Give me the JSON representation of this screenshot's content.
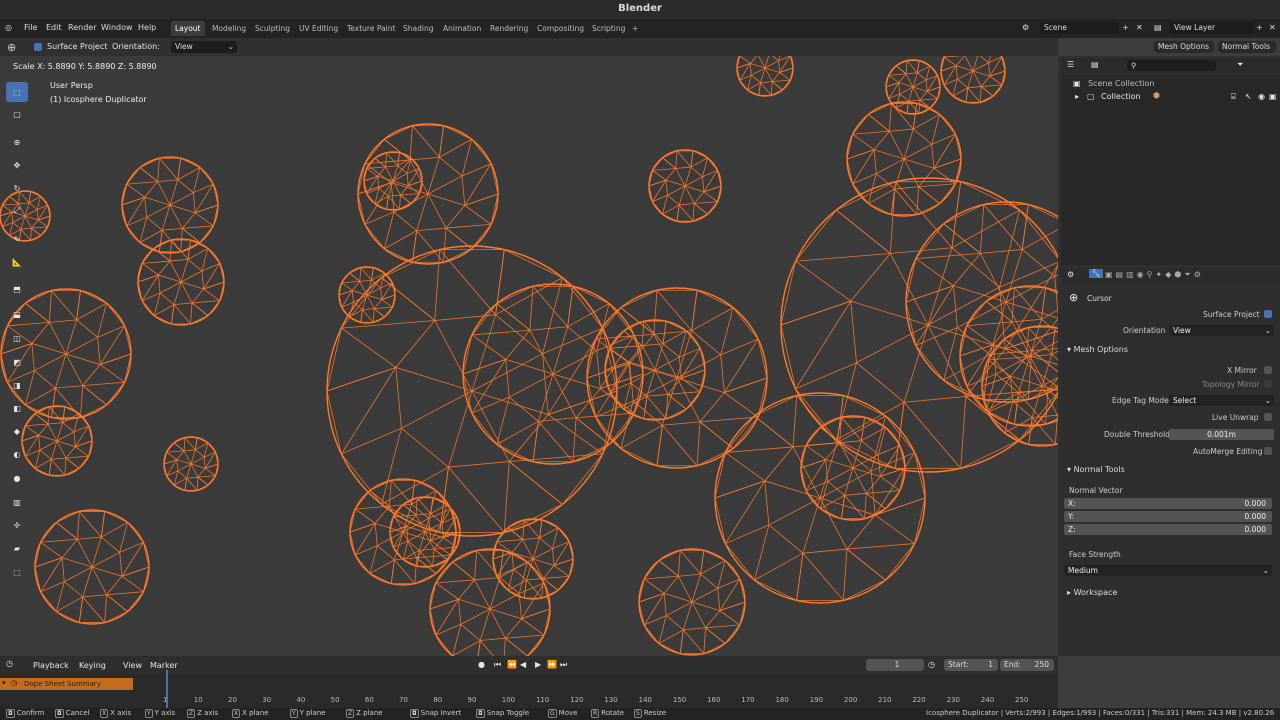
{
  "window": {
    "title": "Blender"
  },
  "menu": {
    "items": [
      "File",
      "Edit",
      "Render",
      "Window",
      "Help"
    ]
  },
  "workspaces": {
    "tabs": [
      "Layout",
      "Modeling",
      "Sculpting",
      "UV Editing",
      "Texture Paint",
      "Shading",
      "Animation",
      "Rendering",
      "Compositing",
      "Scripting"
    ],
    "active": "Layout",
    "add": "+"
  },
  "scene": {
    "name": "Scene",
    "view_layer": "View Layer"
  },
  "tool_header": {
    "surface_project_label": "Surface Project",
    "orientation_label": "Orientation:",
    "orientation_value": "View",
    "mesh_options": "Mesh Options",
    "normal_tools": "Normal Tools"
  },
  "viewport": {
    "scale_readout": "Scale X: 5.8890   Y: 5.8890   Z: 5.8890",
    "view_name": "User Persp",
    "object_name": "(1) Icosphere Duplicator",
    "wire_color": "#ff7a2a"
  },
  "outliner": {
    "search_placeholder": "",
    "scene_collection": "Scene Collection",
    "collection": "Collection"
  },
  "properties": {
    "tool_name": "Cursor",
    "surface_project": "Surface Project",
    "orientation_label": "Orientation",
    "orientation_value": "View",
    "mesh_options": {
      "title": "Mesh Options",
      "x_mirror": "X Mirror",
      "topology_mirror": "Topology Mirror",
      "edge_tag_mode_label": "Edge Tag Mode",
      "edge_tag_mode_value": "Select",
      "live_unwrap": "Live Unwrap",
      "double_threshold_label": "Double Threshold",
      "double_threshold_value": "0.001m",
      "automerge": "AutoMerge Editing"
    },
    "normal_tools": {
      "title": "Normal Tools",
      "normal_vector": "Normal Vector",
      "x_label": "X:",
      "x_value": "0.000",
      "y_label": "Y:",
      "y_value": "0.000",
      "z_label": "Z:",
      "z_value": "0.000",
      "face_strength_label": "Face Strength",
      "face_strength_value": "Medium"
    },
    "workspace": "Workspace"
  },
  "timeline": {
    "menus": [
      "Playback",
      "Keying",
      "View",
      "Marker"
    ],
    "current_frame": "1",
    "start_label": "Start:",
    "start_value": "1",
    "end_label": "End:",
    "end_value": "250",
    "channel": "Dope Sheet Summary",
    "ticks": [
      "1",
      "10",
      "20",
      "30",
      "40",
      "50",
      "60",
      "70",
      "80",
      "90",
      "100",
      "110",
      "120",
      "130",
      "140",
      "150",
      "160",
      "170",
      "180",
      "190",
      "200",
      "210",
      "220",
      "230",
      "240",
      "250"
    ]
  },
  "statusbar": {
    "items": [
      "Confirm",
      "Cancel",
      "X axis",
      "Y axis",
      "Z axis",
      "X plane",
      "Y plane",
      "Z plane",
      "Snap Invert",
      "Snap Toggle",
      "Move",
      "Rotate",
      "Resize"
    ],
    "keys": [
      "",
      "",
      "X",
      "Y",
      "Z",
      "X",
      "Y",
      "Z",
      "",
      "",
      "G",
      "R",
      "S"
    ],
    "stats": "Icosphere Duplicator | Verts:2/993 | Edges:1/993 | Faces:0/331 | Tris:331 | Mem: 24.3 MB | v2.80.26"
  }
}
